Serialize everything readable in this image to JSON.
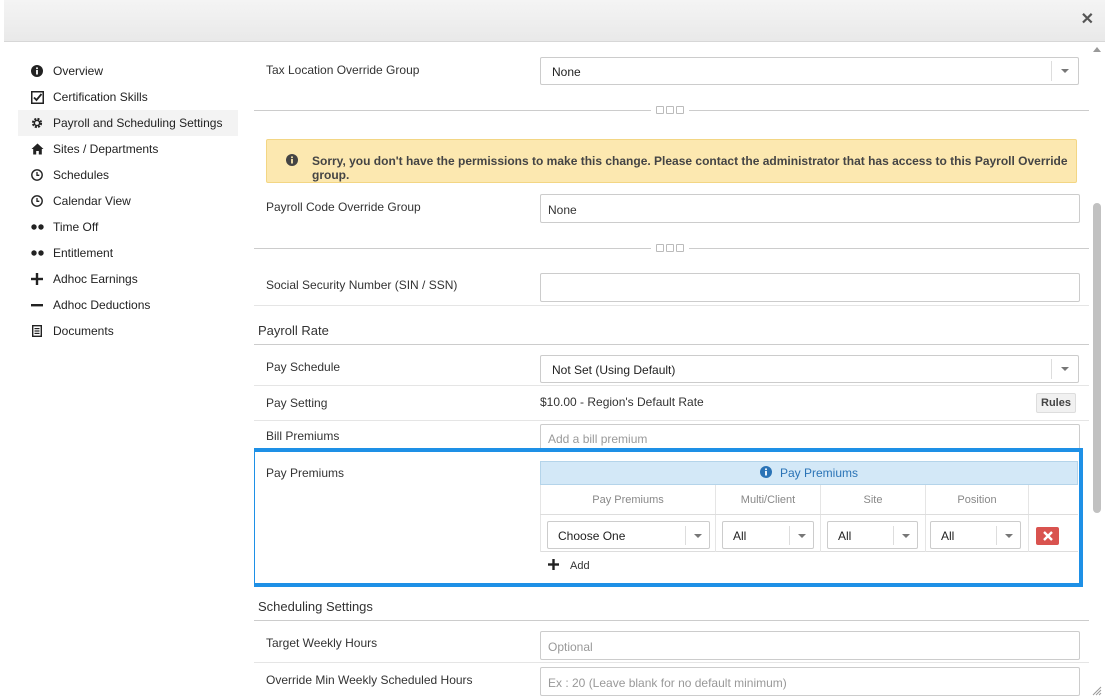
{
  "window": {
    "close_label": "✕"
  },
  "sidebar": {
    "items": [
      {
        "label": "Overview",
        "icon": "info-circle-icon"
      },
      {
        "label": "Certification Skills",
        "icon": "checkbox-icon"
      },
      {
        "label": "Payroll and Scheduling Settings",
        "icon": "gear-icon"
      },
      {
        "label": "Sites / Departments",
        "icon": "home-icon"
      },
      {
        "label": "Schedules",
        "icon": "clock-icon"
      },
      {
        "label": "Calendar View",
        "icon": "clock-icon"
      },
      {
        "label": "Time Off",
        "icon": "dots-icon"
      },
      {
        "label": "Entitlement",
        "icon": "dots-icon"
      },
      {
        "label": "Adhoc Earnings",
        "icon": "plus-icon"
      },
      {
        "label": "Adhoc Deductions",
        "icon": "minus-icon"
      },
      {
        "label": "Documents",
        "icon": "document-icon"
      }
    ],
    "active_index": 2
  },
  "form": {
    "tax_location": {
      "label": "Tax Location Override Group",
      "value": "None"
    },
    "warning": {
      "text": "Sorry, you don't have the permissions to make this change. Please contact the administrator that has access to this Payroll Override group."
    },
    "payroll_code": {
      "label": "Payroll Code Override Group",
      "value": "None"
    },
    "ssn": {
      "label": "Social Security Number (SIN / SSN)",
      "value": ""
    },
    "payroll_rate_title": "Payroll Rate",
    "pay_schedule": {
      "label": "Pay Schedule",
      "value": "Not Set (Using Default)"
    },
    "pay_setting": {
      "label": "Pay Setting",
      "value": "$10.00 - Region's Default Rate",
      "rules_label": "Rules"
    },
    "bill_premiums": {
      "label": "Bill Premiums",
      "placeholder": "Add a bill premium"
    },
    "pay_premiums": {
      "label": "Pay Premiums",
      "header": "Pay Premiums",
      "columns": [
        "Pay Premiums",
        "Multi/Client",
        "Site",
        "Position"
      ],
      "row": {
        "premium": "Choose One",
        "multi_client": "All",
        "site": "All",
        "position": "All"
      },
      "add_label": "Add"
    },
    "scheduling_title": "Scheduling Settings",
    "target_weekly_hours": {
      "label": "Target Weekly Hours",
      "placeholder": "Optional"
    },
    "override_min_hours": {
      "label": "Override Min Weekly Scheduled Hours",
      "placeholder": "Ex : 20 (Leave blank for no default minimum)"
    }
  },
  "colors": {
    "highlight": "#1e90e6",
    "warning_bg": "#fce8b0",
    "premium_header_bg": "#d3e8f7",
    "delete": "#d9534f"
  }
}
